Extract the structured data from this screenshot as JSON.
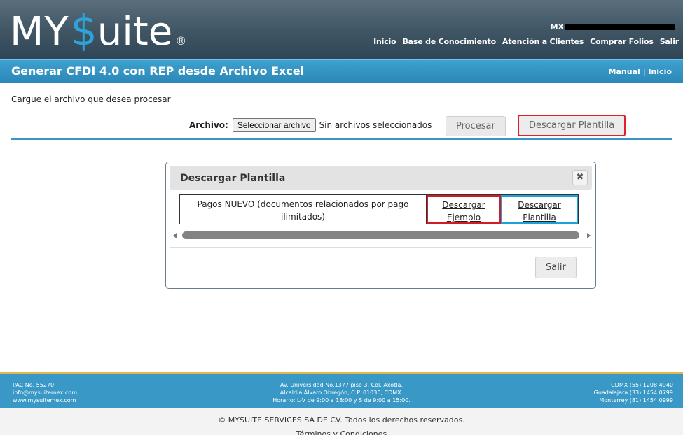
{
  "logo": {
    "my": "MY",
    "dollar": "$",
    "rest": "uite",
    "reg": "®"
  },
  "header": {
    "user_prefix": "MX",
    "nav": [
      "Inicio",
      "Base de Conocimiento",
      "Atención a Clientes",
      "Comprar Folios",
      "Salir"
    ]
  },
  "titlebar": {
    "title": "Generar  CFDI 4.0  con REP desde Archivo Excel",
    "manual": "Manual",
    "sep": " | ",
    "inicio": "Inicio"
  },
  "main": {
    "instruction": "Cargue el archivo que desea procesar",
    "archivo_label": "Archivo:",
    "file_button": "Seleccionar archivo",
    "no_file": "Sin archivos seleccionados",
    "procesar": "Procesar",
    "descargar_plantilla": "Descargar Plantilla"
  },
  "modal": {
    "title": "Descargar Plantilla",
    "close": "✖",
    "row": {
      "desc": "Pagos NUEVO (documentos relacionados por pago ilimitados)",
      "ejemplo": "Descargar Ejemplo",
      "plantilla": "Descargar Plantilla"
    },
    "salir": "Salir"
  },
  "footer": {
    "left": [
      "PAC No. 55270",
      "info@mysuitemex.com",
      "www.mysuitemex.com"
    ],
    "center": [
      "Av. Universidad No.1377 piso 3, Col. Axotla,",
      "Alcaldía Álvaro Obregón, C.P. 01030, CDMX.",
      "Horario: L-V de 9:00 a 18:00 y S de 9:00 a 15:00."
    ],
    "right": [
      "CDMX (55) 1208 4940",
      "Guadalajara (33) 1454 0799",
      "Monterrey (81) 1454 0999"
    ],
    "copyright": "© MYSUITE SERVICES SA DE CV. Todos los derechos reservados.",
    "terms": "Términos y Condiciones"
  },
  "colors": {
    "accent_blue": "#2b87b7",
    "highlight_red": "#e0202a",
    "highlight_cyan": "#1ba3d8",
    "footer_gold": "#e0b84a"
  }
}
